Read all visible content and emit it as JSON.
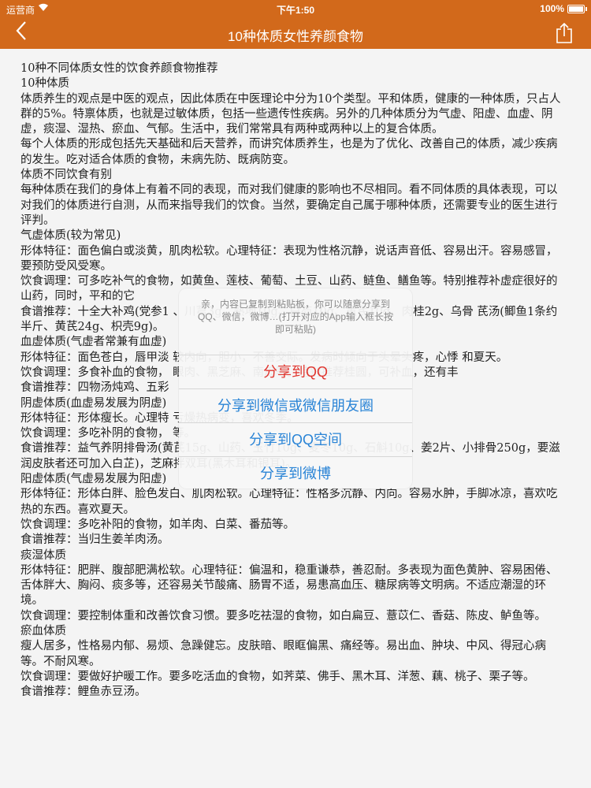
{
  "status_bar": {
    "carrier": "运营商",
    "time": "下午1:50",
    "battery": "100%"
  },
  "nav": {
    "title": "10种体质女性养颜食物"
  },
  "article": [
    "10种不同体质女性的饮食养颜食物推荐",
    "10种体质",
    "体质养生的观点是中医的观点，因此体质在中医理论中分为10个类型。平和体质，健康的一种体质，只占人群的5%。特禀体质，也就是过敏体质，包括一些遗传性疾病。另外的几种体质分为气虚、阳虚、血虚、阴虚，痰湿、湿热、瘀血、气郁。生活中，我们常常具有两种或两种以上的复合体质。",
    "每个人体质的形成包括先天基础和后天营养，而讲究体质养生，也是为了优化、改善自己的体质，减少疾病的发生。吃对适合体质的食物，未病先防、既病防变。",
    "体质不同饮食有别",
    "每种体质在我们的身体上有着不同的表现，而对我们健康的影响也不尽相同。看不同体质的具体表现，可以对我们的体质进行自测，从而来指导我们的饮食。当然，要确定自己属于哪种体质，还需要专业的医生进行评判。",
    "气虚体质(较为常见)",
    "形体特征：面色偏白或淡黄，肌肉松软。心理特征：表现为性格沉静，说话声音低、容易出汗。容易感冒，要预防受风受寒。",
    "饮食调理：可多吃补气的食物，如黄鱼、莲枝、葡萄、土豆、山药、鲢鱼、鳝鱼等。特别推荐补虚症很好的山药，同时，平和的它",
    "食谱推荐：十全大补鸡(党参1                      、川芎3g、熟地10g、白芍10g、黄芪10g、肉桂2g、乌骨                                 芪汤(鲫鱼1条约半斤、黄芪24g、枳壳9g)。",
    "血虚体质(气虚者常兼有血虚)",
    "形体特征：面色苍白，唇甲淡                                                    较内向，胆小，不善交际。发病时倾向于头晕头疼，心悸                                                和夏天。",
    "饮食调理：多食补血的食物，                                        眼肉、黑芝麻、南瓜等。特别推荐桂圆，可补血，还有丰",
    "食谱推荐：四物汤炖鸡、五彩",
    "阴虚体质(血虚易发展为阴虚)",
    "形体特征：形体瘦长。心理特                                           亏燥热病变，喜欢冬季。",
    "饮食调理：多吃补阴的食物，                                           等。",
    "食谱推荐：益气养阴排骨汤(黄芪15g、山药、玉竹10g、麦冬10g、石斛10g、姜2片、小排骨250g，要滋润皮肤者还可加入白芷)，芝麻拌双耳(黑木耳和银耳)。",
    "阳虚体质(气虚易发展为阳虚)",
    "形体特征：形体白胖、脸色发白、肌肉松软。心理特征：性格多沉静、内向。容易水肿，手脚冰凉，喜欢吃热的东西。喜欢夏天。",
    "饮食调理：多吃补阳的食物，如羊肉、白菜、番茄等。",
    "食谱推荐：当归生姜羊肉汤。",
    "痰湿体质",
    "形体特征：肥胖、腹部肥满松软。心理特征：偏温和，稳重谦恭，善忍耐。多表现为面色黄肿、容易困倦、舌体胖大、胸闷、痰多等，还容易关节酸痛、肠胃不适，易患高血压、糖尿病等文明病。不适应潮湿的环境。",
    "饮食调理：要控制体重和改善饮食习惯。要多吃祛湿的食物，如白扁豆、薏苡仁、香菇、陈皮、鲈鱼等。",
    "瘀血体质",
    "瘦人居多，性格易内郁、易烦、急躁健忘。皮肤暗、眼眶偏黑、痛经等。易出血、肿块、中风、得冠心病等。不耐风寒。",
    "饮食调理：要做好护暖工作。要多吃活血的食物，如荠菜、佛手、黑木耳、洋葱、藕、桃子、栗子等。",
    "食谱推荐：鲤鱼赤豆汤。"
  ],
  "share_sheet": {
    "message": "亲，内容已复制到粘贴板，你可以随意分享到QQ、微信，微博…(打开对应的App输入框长按即可粘贴)",
    "buttons": [
      "分享到QQ",
      "分享到微信或微信朋友圈",
      "分享到QQ空间",
      "分享到微博"
    ]
  },
  "colors": {
    "nav_bg": "#d2691b",
    "qq_red": "#e0362f",
    "link_blue": "#2a84d6"
  }
}
